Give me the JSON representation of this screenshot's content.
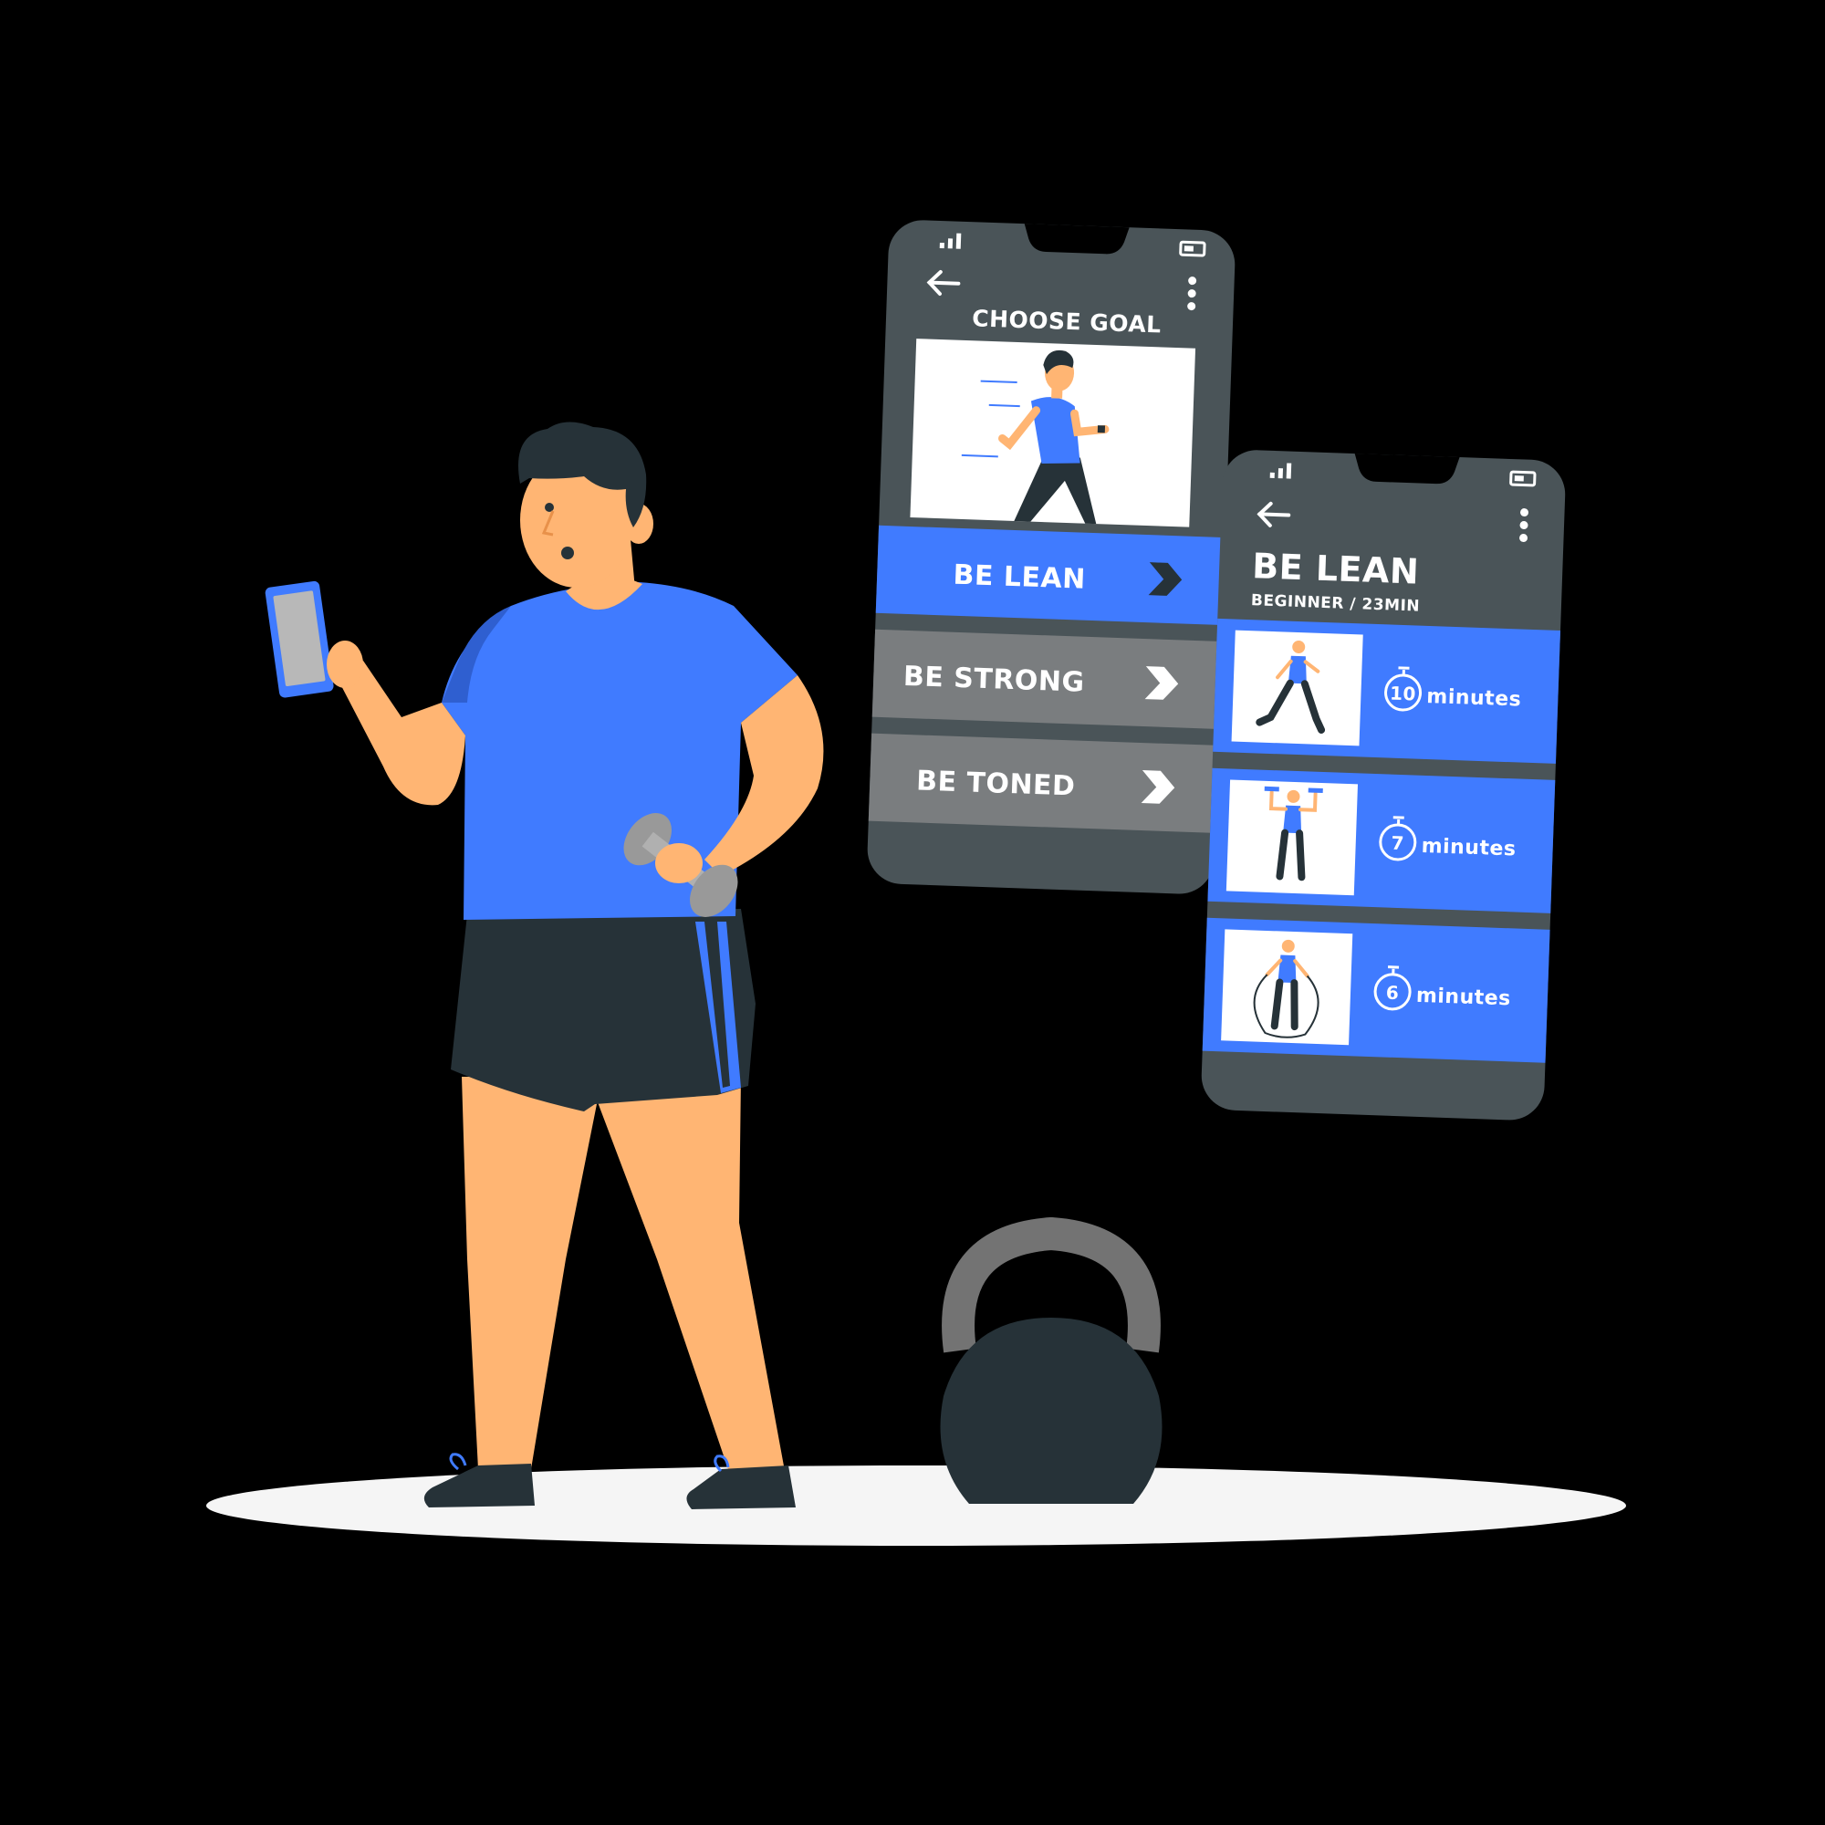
{
  "colors": {
    "background": "#000000",
    "phone_body": "#4a5458",
    "phone_item_gray": "#7a7d7f",
    "accent_blue": "#407bff",
    "skin": "#ffb573",
    "hair_dark": "#263238",
    "shorts": "#263238",
    "floor_shadow": "#f5f5f5",
    "kettlebell": "#263238",
    "kettlebell_handle": "#737373"
  },
  "phone_goal": {
    "status_signal": "signal-icon",
    "status_battery": "battery-icon",
    "back_icon": "arrow-left-icon",
    "menu_icon": "more-vertical-icon",
    "title": "CHOOSE GOAL",
    "options": [
      {
        "label": "BE LEAN",
        "selected": true
      },
      {
        "label": "BE STRONG",
        "selected": false
      },
      {
        "label": "BE TONED",
        "selected": false
      }
    ]
  },
  "phone_plan": {
    "back_icon": "arrow-left-icon",
    "menu_icon": "more-vertical-icon",
    "title": "BE LEAN",
    "subtitle": "BEGINNER / 23MIN",
    "workouts": [
      {
        "minutes": "10",
        "unit": "minutes",
        "icon": "stopwatch-icon"
      },
      {
        "minutes": "7",
        "unit": "minutes",
        "icon": "stopwatch-icon"
      },
      {
        "minutes": "6",
        "unit": "minutes",
        "icon": "stopwatch-icon"
      }
    ]
  }
}
